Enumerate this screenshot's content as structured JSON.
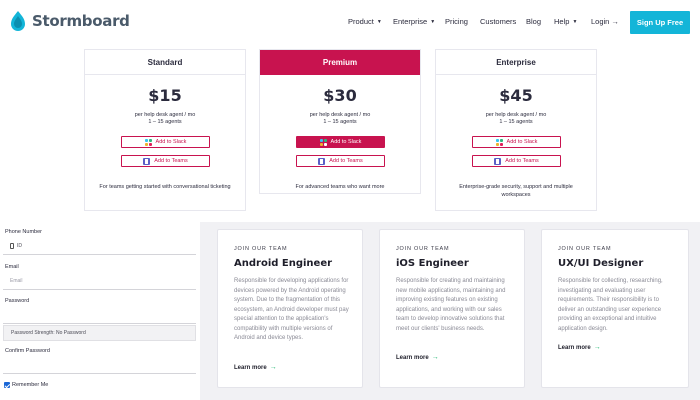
{
  "nav": {
    "logo_text": "Stormboard",
    "items": [
      {
        "label": "Product",
        "dropdown": true
      },
      {
        "label": "Enterprise",
        "dropdown": true
      },
      {
        "label": "Pricing",
        "dropdown": false
      },
      {
        "label": "Customers",
        "dropdown": false
      },
      {
        "label": "Blog",
        "dropdown": false
      },
      {
        "label": "Help",
        "dropdown": true
      },
      {
        "label": "Login →",
        "dropdown": false
      }
    ],
    "signup_label": "Sign Up Free",
    "signup_color": "#13b5d8"
  },
  "plans": [
    {
      "name": "Standard",
      "price": "$15",
      "sub1": "per help desk agent / mo",
      "sub2": "1 – 15 agents",
      "slack_label": "Add to Slack",
      "teams_label": "Add to Teams",
      "desc": "For teams getting started with conversational ticketing"
    },
    {
      "name": "Premium",
      "price": "$30",
      "sub1": "per help desk agent / mo",
      "sub2": "1 – 15 agents",
      "slack_label": "Add to Slack",
      "teams_label": "Add to Teams",
      "desc": "For advanced teams who want more"
    },
    {
      "name": "Enterprise",
      "price": "$45",
      "sub1": "per help desk agent / mo",
      "sub2": "1 – 15 agents",
      "slack_label": "Add to Slack",
      "teams_label": "Add to Teams",
      "desc": "Enterprise-grade security, support and multiple workspaces"
    }
  ],
  "accent_color": "#c8134f",
  "form": {
    "phone_label": "Phone Number",
    "phone_value": "ID",
    "email_label": "Email",
    "email_placeholder": "Email",
    "password_label": "Password",
    "password_value": "Password Strength: No Password",
    "confirm_label": "Confirm Password",
    "remember_label": "Remember Me",
    "remember_checked": true
  },
  "jobs": [
    {
      "eyebrow": "JOIN OUR TEAM",
      "title": "Android Engineer",
      "desc": "Responsible for developing applications for devices powered by the Android operating system. Due to the fragmentation of this ecosystem, an Android developer must pay special attention to the application's compatibility with multiple versions of Android and device types.",
      "link": "Learn more"
    },
    {
      "eyebrow": "JOIN OUR TEAM",
      "title": "iOS Engineer",
      "desc": "Responsible for creating and maintaining new mobile applications, maintaining and improving existing features on existing applications, and working with our sales team to develop innovative solutions that meet our clients' business needs.",
      "link": "Learn more"
    },
    {
      "eyebrow": "JOIN OUR TEAM",
      "title": "UX/UI Designer",
      "desc": "Responsible for collecting, researching, investigating and evaluating user requirements. Their responsibility is to deliver an outstanding user experience providing an exceptional and intuitive application design.",
      "link": "Learn more"
    }
  ]
}
